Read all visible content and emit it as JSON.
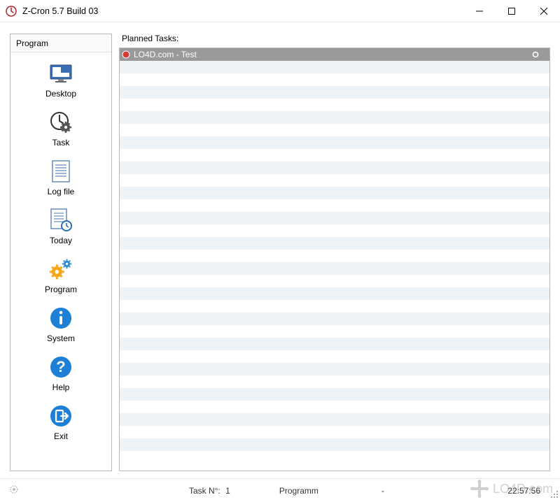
{
  "window": {
    "title": "Z-Cron 5.7 Build 03"
  },
  "sidebar": {
    "header": "Program",
    "items": [
      {
        "label": "Desktop"
      },
      {
        "label": "Task"
      },
      {
        "label": "Log file"
      },
      {
        "label": "Today"
      },
      {
        "label": "Program"
      },
      {
        "label": "System"
      },
      {
        "label": "Help"
      },
      {
        "label": "Exit"
      }
    ]
  },
  "main": {
    "header": "Planned Tasks:",
    "tasks": [
      {
        "name": "LO4D.com - Test",
        "selected": true
      }
    ],
    "total_rows": 33
  },
  "status": {
    "task_no_label": "Task N°:",
    "task_no_value": "1",
    "program_label": "Programm",
    "program_value": "-",
    "time": "22:57:56"
  },
  "watermark": "LO4D.com"
}
